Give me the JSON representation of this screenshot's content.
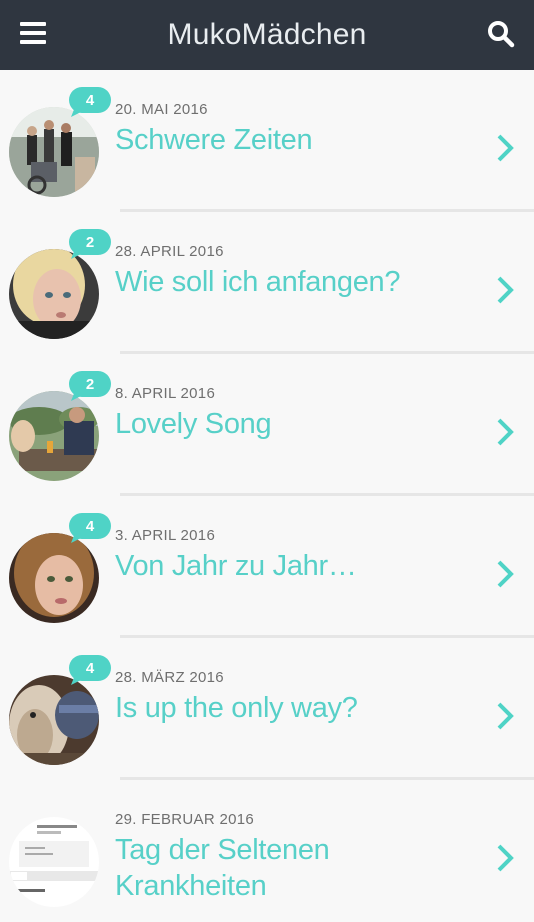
{
  "header": {
    "title": "MukoMädchen"
  },
  "colors": {
    "header_bg": "#2f3640",
    "accent": "#57d0c8",
    "badge": "#4fd3c6"
  },
  "posts": [
    {
      "date": "20. MAI 2016",
      "title": "Schwere Zeiten",
      "comments": "4"
    },
    {
      "date": "28. APRIL 2016",
      "title": "Wie soll ich anfangen?",
      "comments": "2"
    },
    {
      "date": "8. APRIL 2016",
      "title": "Lovely Song",
      "comments": "2"
    },
    {
      "date": "3. APRIL 2016",
      "title": "Von Jahr zu Jahr…",
      "comments": "4"
    },
    {
      "date": "28. MÄRZ 2016",
      "title": "Is up the only way?",
      "comments": "4"
    },
    {
      "date": "29. FEBRUAR 2016",
      "title": "Tag der Seltenen Krankheiten",
      "comments": ""
    }
  ]
}
